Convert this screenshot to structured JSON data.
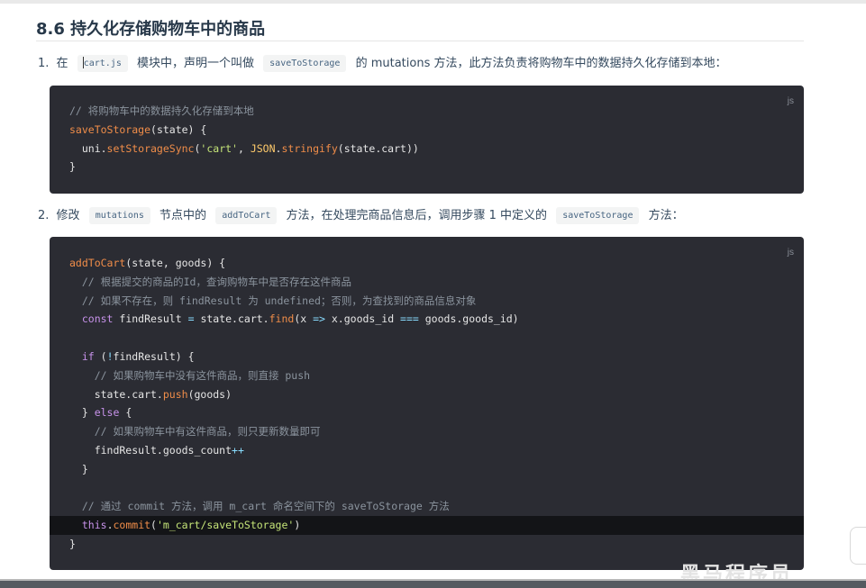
{
  "heading": "8.6 持久化存储购物车中的商品",
  "step1": {
    "num": "1.",
    "t1": "在",
    "code1": "cart.js",
    "t2": "模块中，声明一个叫做",
    "code2": "saveToStorage",
    "t3": "的 mutations 方法，此方法负责将购物车中的数据持久化存储到本地："
  },
  "step2": {
    "num": "2.",
    "t1": "修改",
    "code1": "mutations",
    "t2": "节点中的",
    "code2": "addToCart",
    "t3": "方法，在处理完商品信息后，调用步骤 1 中定义的",
    "code3": "saveToStorage",
    "t4": "方法："
  },
  "code1": {
    "lang": "js",
    "lines": [
      {
        "parts": [
          {
            "t": "// 将购物车中的数据持久化存储到本地",
            "c": "c"
          }
        ]
      },
      {
        "parts": [
          {
            "t": "saveToStorage",
            "c": "f"
          },
          {
            "t": "(state) {",
            "c": ""
          }
        ]
      },
      {
        "parts": [
          {
            "t": "  uni.",
            "c": ""
          },
          {
            "t": "setStorageSync",
            "c": "f"
          },
          {
            "t": "(",
            "c": ""
          },
          {
            "t": "'cart'",
            "c": "s"
          },
          {
            "t": ", ",
            "c": ""
          },
          {
            "t": "JSON",
            "c": "y"
          },
          {
            "t": ".",
            "c": ""
          },
          {
            "t": "stringify",
            "c": "f"
          },
          {
            "t": "(state.cart))",
            "c": ""
          }
        ]
      },
      {
        "parts": [
          {
            "t": "}",
            "c": ""
          }
        ]
      }
    ]
  },
  "code2": {
    "lang": "js",
    "lines": [
      {
        "parts": [
          {
            "t": "addToCart",
            "c": "f"
          },
          {
            "t": "(state, goods) {",
            "c": ""
          }
        ]
      },
      {
        "parts": [
          {
            "t": "  // 根据提交的商品的Id，查询购物车中是否存在这件商品",
            "c": "c"
          }
        ]
      },
      {
        "parts": [
          {
            "t": "  // 如果不存在，则 findResult 为 undefined；否则，为查找到的商品信息对象",
            "c": "c"
          }
        ]
      },
      {
        "parts": [
          {
            "t": "  ",
            "c": ""
          },
          {
            "t": "const",
            "c": "k"
          },
          {
            "t": " findResult ",
            "c": ""
          },
          {
            "t": "=",
            "c": "o"
          },
          {
            "t": " state.cart.",
            "c": ""
          },
          {
            "t": "find",
            "c": "f"
          },
          {
            "t": "(x ",
            "c": ""
          },
          {
            "t": "=>",
            "c": "o"
          },
          {
            "t": " x.goods_id ",
            "c": ""
          },
          {
            "t": "===",
            "c": "o"
          },
          {
            "t": " goods.goods_id)",
            "c": ""
          }
        ]
      },
      {
        "parts": [
          {
            "t": "",
            "c": ""
          }
        ]
      },
      {
        "parts": [
          {
            "t": "  ",
            "c": ""
          },
          {
            "t": "if",
            "c": "k"
          },
          {
            "t": " (",
            "c": ""
          },
          {
            "t": "!",
            "c": "o"
          },
          {
            "t": "findResult) {",
            "c": ""
          }
        ]
      },
      {
        "parts": [
          {
            "t": "    // 如果购物车中没有这件商品，则直接 push",
            "c": "c"
          }
        ]
      },
      {
        "parts": [
          {
            "t": "    state.cart.",
            "c": ""
          },
          {
            "t": "push",
            "c": "f"
          },
          {
            "t": "(goods)",
            "c": ""
          }
        ]
      },
      {
        "parts": [
          {
            "t": "  } ",
            "c": ""
          },
          {
            "t": "else",
            "c": "k"
          },
          {
            "t": " {",
            "c": ""
          }
        ]
      },
      {
        "parts": [
          {
            "t": "    // 如果购物车中有这件商品，则只更新数量即可",
            "c": "c"
          }
        ]
      },
      {
        "parts": [
          {
            "t": "    findResult.goods_count",
            "c": ""
          },
          {
            "t": "++",
            "c": "o"
          }
        ]
      },
      {
        "parts": [
          {
            "t": "  }",
            "c": ""
          }
        ]
      },
      {
        "parts": [
          {
            "t": "",
            "c": ""
          }
        ]
      },
      {
        "parts": [
          {
            "t": "  // 通过 commit 方法，调用 m_cart 命名空间下的 saveToStorage 方法",
            "c": "c"
          }
        ]
      },
      {
        "hl": true,
        "parts": [
          {
            "t": "  ",
            "c": ""
          },
          {
            "t": "this",
            "c": "k"
          },
          {
            "t": ".",
            "c": ""
          },
          {
            "t": "commit",
            "c": "f"
          },
          {
            "t": "(",
            "c": ""
          },
          {
            "t": "'m_cart/saveToStorage'",
            "c": "s"
          },
          {
            "t": ")",
            "c": ""
          }
        ]
      },
      {
        "parts": [
          {
            "t": "}",
            "c": ""
          }
        ]
      }
    ]
  },
  "watermark": "黑马程序员",
  "colors": {
    "code_bg": "#2b2c33",
    "comment": "#8b949e",
    "function": "#f08d49",
    "string": "#c5e478",
    "keyword": "#c792ea"
  }
}
